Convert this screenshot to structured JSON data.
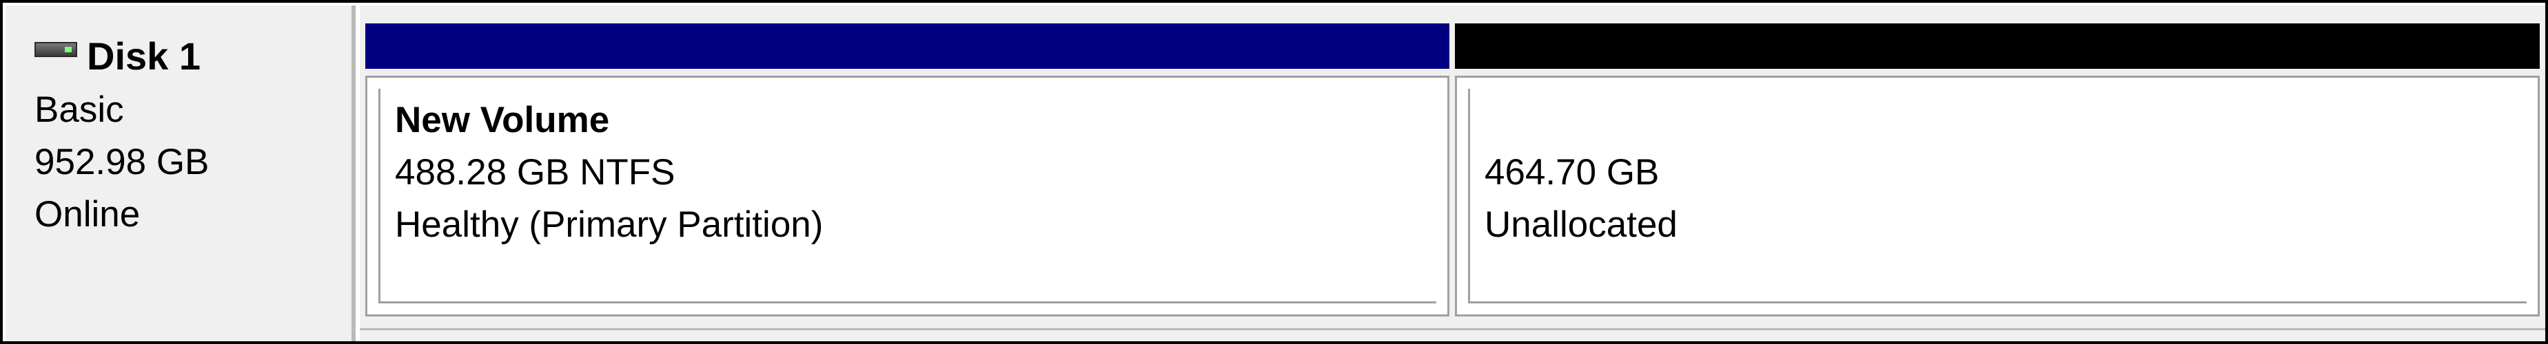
{
  "disk": {
    "title": "Disk 1",
    "type": "Basic",
    "size": "952.98 GB",
    "status": "Online",
    "icon": "disk-drive-icon"
  },
  "partitions": [
    {
      "name": "New Volume",
      "size_fs": "488.28 GB NTFS",
      "status": "Healthy (Primary Partition)",
      "header_color": "#000080"
    },
    {
      "name": "",
      "size_fs": "464.70 GB",
      "status": "Unallocated",
      "header_color": "#000000"
    }
  ]
}
